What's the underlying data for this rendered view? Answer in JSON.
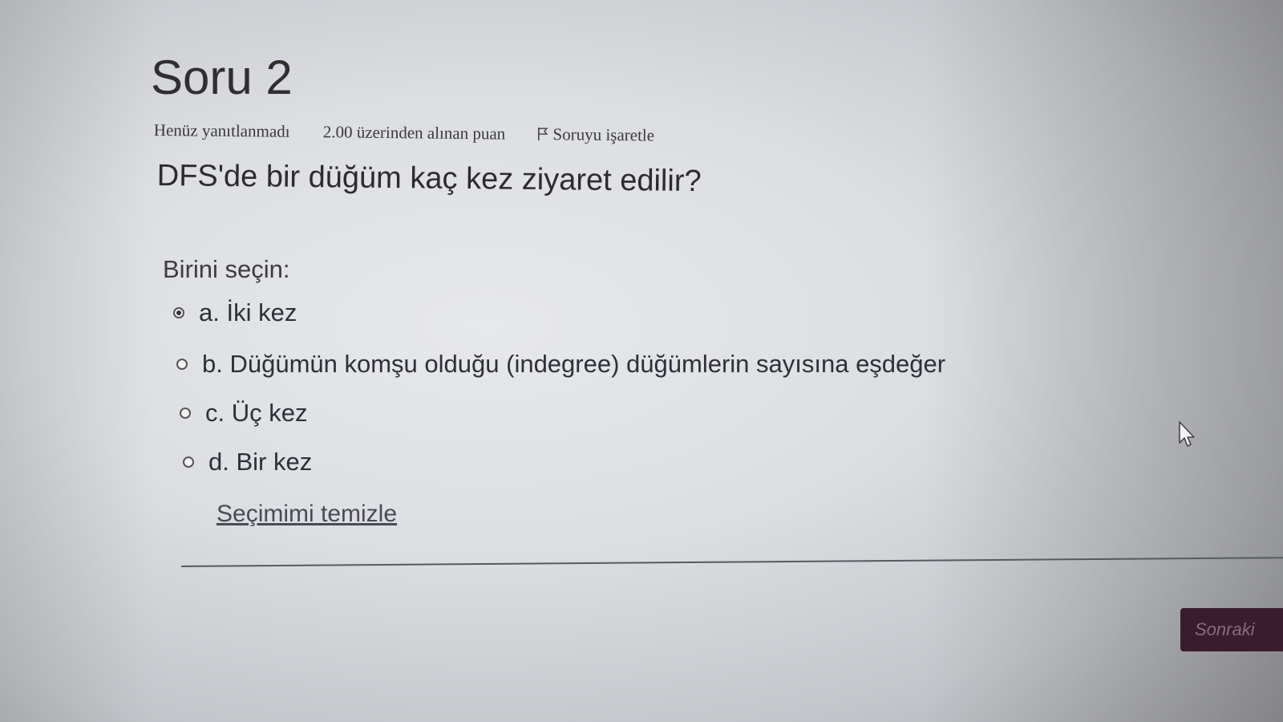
{
  "question": {
    "title": "Soru 2",
    "status": "Henüz yanıtlanmadı",
    "grade": "2.00 üzerinden alınan puan",
    "flag_label": "Soruyu işaretle",
    "text": "DFS'de bir düğüm kaç kez ziyaret edilir?",
    "prompt": "Birini seçin:"
  },
  "answers": [
    {
      "label": "a. İki kez",
      "selected": true
    },
    {
      "label": "b. Düğümün komşu olduğu (indegree) düğümlerin sayısına eşdeğer",
      "selected": false
    },
    {
      "label": "c. Üç kez",
      "selected": false
    },
    {
      "label": "d. Bir kez",
      "selected": false
    }
  ],
  "clear_choice_label": "Seçimimi temizle",
  "navigation": {
    "next_label": "Sonraki"
  },
  "icons": {
    "flag": "flag-icon",
    "cursor": "mouse-pointer-icon"
  },
  "colors": {
    "next_button_bg": "#3a1d2c"
  }
}
